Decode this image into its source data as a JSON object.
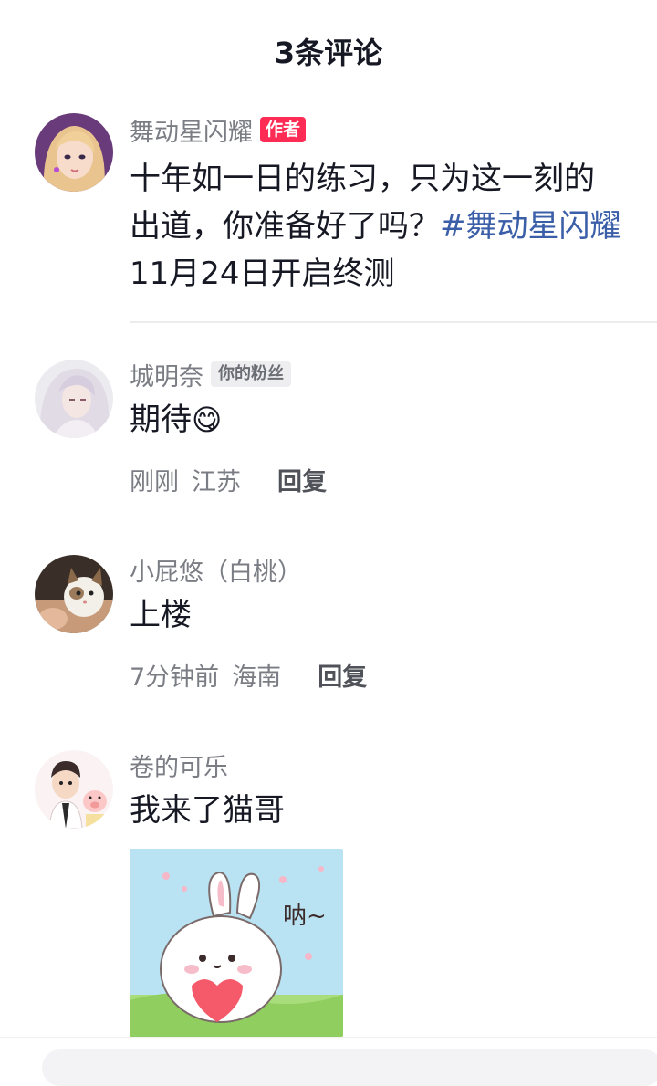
{
  "header": {
    "title": "3条评论"
  },
  "comments": [
    {
      "name": "舞动星闪耀",
      "badge": "作者",
      "text_line1": "十年如一日的练习，只为这一刻的",
      "text_line2_plain": "出道，你准备好了吗？",
      "text_line2_hashtag": "#舞动星闪耀",
      "text_line3": "11月24日开启终测"
    },
    {
      "name": "城明奈",
      "badge": "你的粉丝",
      "text": "期待",
      "emoji": "😋",
      "time": "刚刚",
      "location": "江苏",
      "reply": "回复"
    },
    {
      "name": "小屁悠（白桃）",
      "text": "上楼",
      "time": "7分钟前",
      "location": "海南",
      "reply": "回复"
    },
    {
      "name": "卷的可乐",
      "text": "我来了猫哥",
      "sticker_text": "呐~"
    }
  ]
}
